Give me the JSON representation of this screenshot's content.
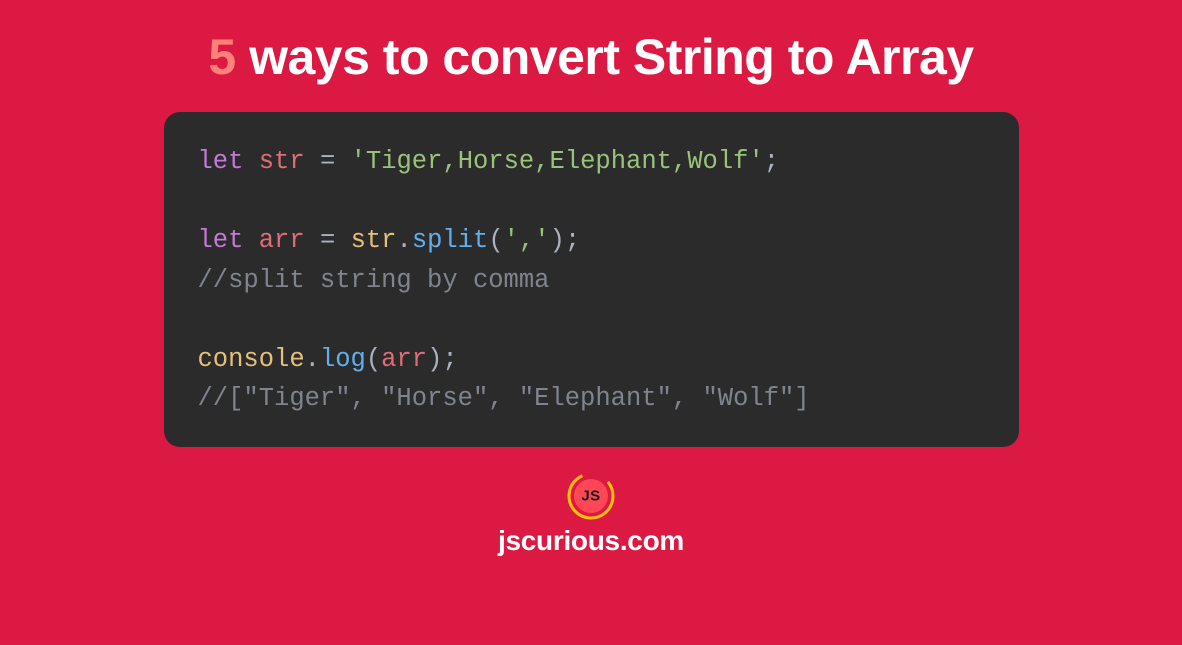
{
  "title": {
    "accent": "5",
    "main": " ways to convert String to Array"
  },
  "code": {
    "line1": {
      "kw": "let",
      "var": "str",
      "op": " = ",
      "str": "'Tiger,Horse,Elephant,Wolf'",
      "end": ";"
    },
    "line3": {
      "kw": "let",
      "var": "arr",
      "op": " = ",
      "obj": "str",
      "dot": ".",
      "func": "split",
      "open": "(",
      "arg": "','",
      "close": ");"
    },
    "line4": {
      "comment": "//split string by comma"
    },
    "line6": {
      "obj": "console",
      "dot": ".",
      "func": "log",
      "open": "(",
      "param": "arr",
      "close": ");"
    },
    "line7": {
      "comment": "//[\"Tiger\", \"Horse\", \"Elephant\", \"Wolf\"]"
    }
  },
  "footer": {
    "logo_text": "JS",
    "site": "jscurious.com"
  }
}
